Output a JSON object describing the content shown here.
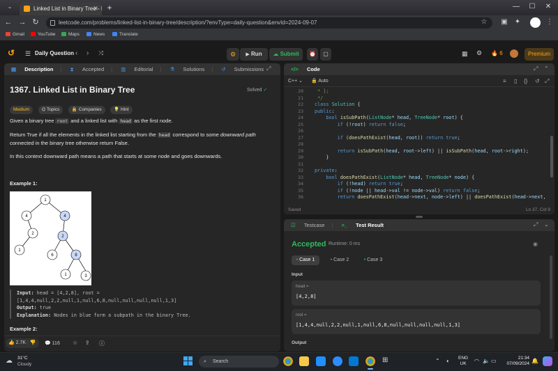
{
  "browser": {
    "tab_title": "Linked List in Binary Tree - Leetc",
    "url": "leetcode.com/problems/linked-list-in-binary-tree/description/?envType=daily-question&envId=2024-09-07",
    "bookmarks": [
      "Gmail",
      "YouTube",
      "Maps",
      "News",
      "Translate"
    ]
  },
  "header": {
    "daily_label": "Daily Question",
    "run_label": "Run",
    "submit_label": "Submit",
    "streak": "6",
    "premium_label": "Premium"
  },
  "left_tabs": [
    "Description",
    "Accepted",
    "Editorial",
    "Solutions",
    "Submissions"
  ],
  "problem": {
    "title": "1367. Linked List in Binary Tree",
    "status": "Solved",
    "difficulty": "Medium",
    "tags": [
      "Topics",
      "Companies",
      "Hint"
    ],
    "p1_a": "Given a binary tree ",
    "p1_code1": "root",
    "p1_b": " and a linked list with ",
    "p1_code2": "head",
    "p1_c": " as the first node.",
    "p2_a": "Return True if all the elements in the linked list starting from the ",
    "p2_code": "head",
    "p2_b": " correspond to some ",
    "p2_em": "downward path",
    "p2_c": " connected in the binary tree otherwise return False.",
    "p3": "In this context downward path means a path that starts at some node and goes downwards.",
    "example1_heading": "Example 1:",
    "input_label": "Input:",
    "input_value": "head = [4,2,8], root = [1,4,4,null,2,2,null,1,null,6,8,null,null,null,null,1,3]",
    "output_label": "Output:",
    "output_value": "true",
    "explanation_label": "Explanation:",
    "explanation_value": "Nodes in blue form a subpath in the binary Tree.",
    "example2_heading": "Example 2:",
    "tree_nodes": [
      "1",
      "4",
      "4",
      "2",
      "2",
      "1",
      "6",
      "8",
      "1",
      "3"
    ]
  },
  "left_footer": {
    "likes": "2.7K",
    "comments": "116"
  },
  "code": {
    "tab_label": "Code",
    "language": "C++",
    "mode": "Auto",
    "saved": "Saved",
    "cursor": "Ln 37, Col 9",
    "line_numbers": [
      "20",
      "21",
      "22",
      "23",
      "24",
      "25",
      "26",
      "27",
      "28",
      "29",
      "30",
      "31",
      "32",
      "33",
      "34",
      "35",
      "36"
    ]
  },
  "result": {
    "testcase_tab": "Testcase",
    "result_tab": "Test Result",
    "status": "Accepted",
    "runtime": "Runtime: 0 ms",
    "cases": [
      "Case 1",
      "Case 2",
      "Case 3"
    ],
    "input_label": "Input",
    "head_label": "head =",
    "head_value": "[4,2,8]",
    "root_label": "root =",
    "root_value": "[1,4,4,null,2,2,null,1,null,6,8,null,null,null,null,1,3]",
    "output_label": "Output"
  },
  "taskbar": {
    "temp": "31°C",
    "weather": "Cloudy",
    "search_placeholder": "Search",
    "lang1": "ENG",
    "lang2": "UK",
    "time": "21:34",
    "date": "07/09/2024"
  },
  "colors": {
    "accent_orange": "#ffa116",
    "accepted_green": "#2cbb5d",
    "highlight_node": "#c9d8f5",
    "medium_yellow": "#ffc01e"
  }
}
